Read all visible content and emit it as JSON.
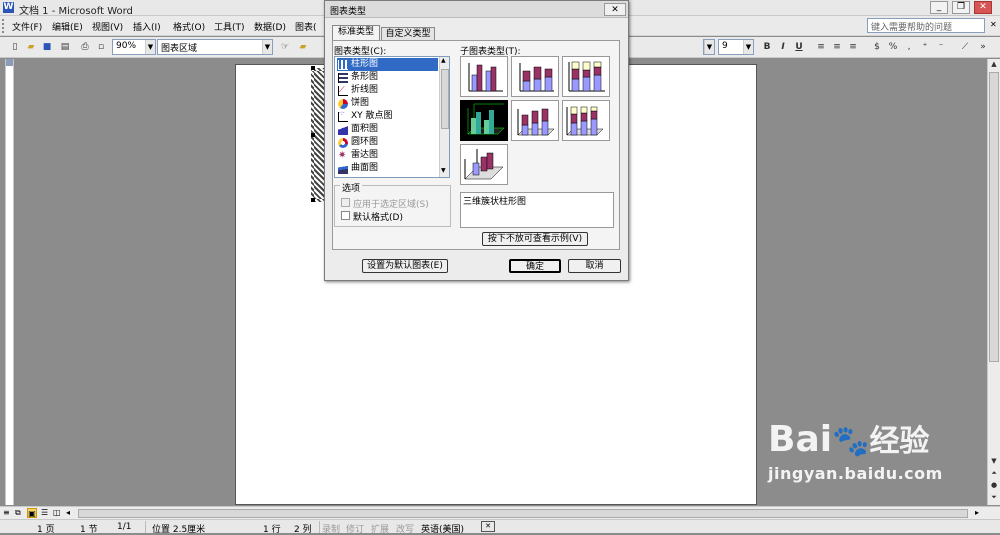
{
  "window": {
    "title": "文档 1 - Microsoft Word",
    "controls": [
      "_",
      "❐",
      "✕"
    ]
  },
  "menu": {
    "items": [
      "文件(F)",
      "编辑(E)",
      "视图(V)",
      "插入(I)",
      "格式(O)",
      "工具(T)",
      "数据(D)",
      "图表("
    ],
    "help_placeholder": "键入需要帮助的问题"
  },
  "toolbar": {
    "zoom": "90%",
    "object": "图表区域",
    "font_size": "9",
    "bold": "B",
    "italic": "I",
    "underline": "U"
  },
  "dialog": {
    "title": "图表类型",
    "tabs": [
      "标准类型",
      "自定义类型"
    ],
    "chart_type_label": "图表类型(C):",
    "subtype_label": "子图表类型(T):",
    "chart_types": [
      "柱形图",
      "条形图",
      "折线图",
      "饼图",
      "XY 散点图",
      "面积图",
      "圆环图",
      "雷达图",
      "曲面图"
    ],
    "options_label": "选项",
    "apply_selection": "应用于选定区域(S)",
    "default_format": "默认格式(D)",
    "description": "三维簇状柱形图",
    "preview_button": "按下不放可查看示例(V)",
    "set_default_button": "设置为默认图表(E)",
    "ok_button": "确定",
    "cancel_button": "取消"
  },
  "status": {
    "page": "1 页",
    "section": "1 节",
    "pages": "1/1",
    "position": "位置 2.5厘米",
    "line": "1 行",
    "column": "2 列",
    "rec": "录制",
    "trk": "修订",
    "ext": "扩展",
    "ovr": "改写",
    "language": "英语(美国)"
  },
  "watermark": {
    "brand": "Bai",
    "brand2": "经验",
    "url": "jingyan.baidu.com"
  },
  "colors": {
    "accent": "#316ac5",
    "bar_purple": "#993366",
    "bar_blue": "#9999ff",
    "bar_yellow": "#ffffcc"
  }
}
